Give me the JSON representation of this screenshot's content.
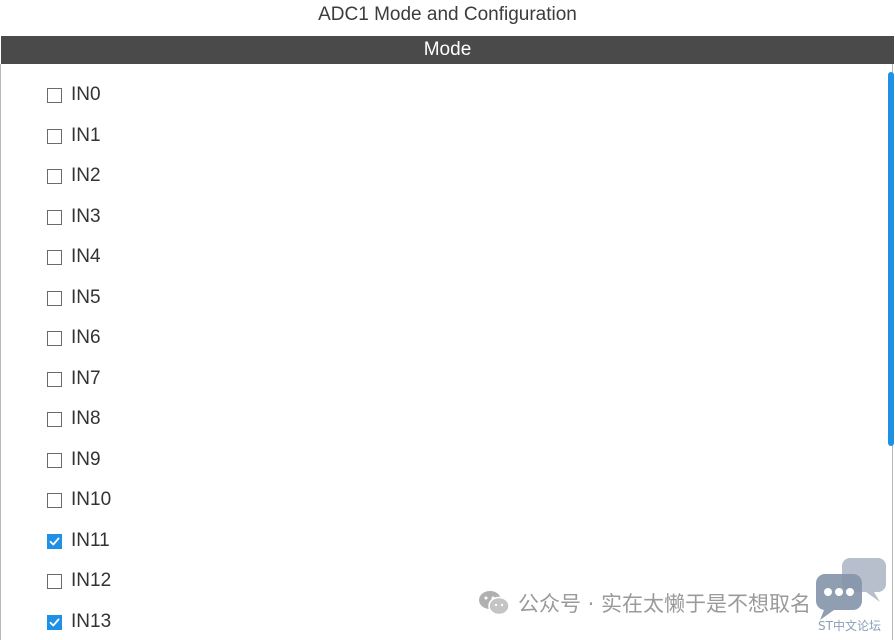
{
  "panel": {
    "title": "ADC1 Mode and Configuration"
  },
  "section": {
    "header": "Mode"
  },
  "channels": [
    {
      "label": "IN0",
      "checked": false
    },
    {
      "label": "IN1",
      "checked": false
    },
    {
      "label": "IN2",
      "checked": false
    },
    {
      "label": "IN3",
      "checked": false
    },
    {
      "label": "IN4",
      "checked": false
    },
    {
      "label": "IN5",
      "checked": false
    },
    {
      "label": "IN6",
      "checked": false
    },
    {
      "label": "IN7",
      "checked": false
    },
    {
      "label": "IN8",
      "checked": false
    },
    {
      "label": "IN9",
      "checked": false
    },
    {
      "label": "IN10",
      "checked": false
    },
    {
      "label": "IN11",
      "checked": true
    },
    {
      "label": "IN12",
      "checked": false
    },
    {
      "label": "IN13",
      "checked": true
    }
  ],
  "watermark": {
    "text": "公众号 · 实在太懒于是不想取名",
    "icon": "wechat-icon"
  },
  "logo": {
    "text": "ST中文论坛",
    "icon": "chat-bubbles-icon"
  },
  "colors": {
    "header_bg": "#4a4a4a",
    "accent": "#1e90e6"
  }
}
